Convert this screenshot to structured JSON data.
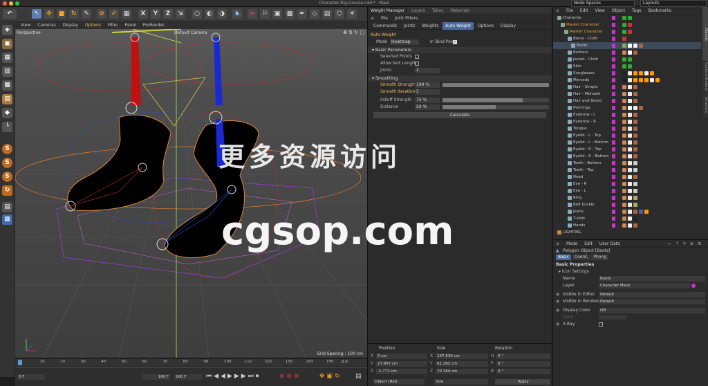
{
  "window": {
    "title": "Character-Rig-Course.c4d * - Main"
  },
  "node_spaces": {
    "label": "Node Spaces",
    "layouts": "Layouts"
  },
  "viewport": {
    "menu": [
      "View",
      "Cameras",
      "Display",
      "Options",
      "Filter",
      "Panel",
      "ProRender"
    ],
    "view_name": "Perspective",
    "camera": "Default Camera",
    "grid_spacing": "Grid Spacing : 100 cm"
  },
  "timeline": {
    "ticks": [
      "0",
      "10",
      "20",
      "30",
      "40",
      "50",
      "60",
      "70",
      "80",
      "90",
      "100",
      "110",
      "120",
      "130",
      "143",
      "150"
    ],
    "current_frame": "0 F",
    "frame_end": "160 F",
    "start_field": "0 F",
    "end_field_a": "160 F",
    "end_field_b": "160 F"
  },
  "weight_manager": {
    "tabs": [
      "Weight Manager",
      "Layers",
      "Takes",
      "Materials"
    ],
    "menu": [
      "File",
      "Joint Filters"
    ],
    "subtabs": [
      "Commands",
      "Joints",
      "Weights",
      "Auto Weight",
      "Options",
      "Display"
    ],
    "section": "Auto Weight",
    "mode_label": "Mode",
    "mode_value": "Heatmap",
    "bind_pose_label": "In Bind Pose",
    "basic_params": "Basic Parameters",
    "selected_points": "Selected Points",
    "allow_null_length": "Allow Null Length",
    "joints_label": "Joints",
    "joints_value": "2",
    "smoothing": "Smoothing",
    "smooth_strength_label": "Smooth Strength",
    "smooth_strength_value": "100 %",
    "smooth_strength": 1.0,
    "smooth_iterations_label": "Smooth Iterations",
    "smooth_iterations_value": "5",
    "falloff_label": "Falloff Strength",
    "falloff_value": "75 %",
    "falloff": 0.75,
    "distance_label": "Distance",
    "distance_value": "50 %",
    "distance": 0.5,
    "calculate": "Calculate"
  },
  "coords": {
    "headers": [
      "Position",
      "Size",
      "Rotation"
    ],
    "rows": [
      {
        "axis": "X",
        "pos": "0 cm",
        "size_axis": "X",
        "size": "107.639 cm",
        "rot_axis": "H",
        "rot": "0 °"
      },
      {
        "axis": "Y",
        "pos": "27.687 cm",
        "size_axis": "Y",
        "size": "61.262 cm",
        "rot_axis": "P",
        "rot": "0 °"
      },
      {
        "axis": "Z",
        "pos": "-1.772 cm",
        "size_axis": "Z",
        "size": "70.164 cm",
        "rot_axis": "B",
        "rot": "0 °"
      }
    ],
    "obj_mode": "Object (Rel)",
    "size_mode": "Size",
    "apply": "Apply"
  },
  "object_manager": {
    "menu": [
      "File",
      "Edit",
      "View",
      "Object",
      "Tags",
      "Bookmarks"
    ],
    "objects": [
      {
        "name": "Character",
        "indent": 0
      },
      {
        "name": "Master Character",
        "indent": 1
      },
      {
        "name": "Master Character",
        "indent": 2
      },
      {
        "name": "Boots - Cloth",
        "indent": 3
      },
      {
        "name": "Boots",
        "indent": 4
      },
      {
        "name": "Buttons",
        "indent": 3
      },
      {
        "name": "Jacket - Cloth",
        "indent": 3
      },
      {
        "name": "Skin",
        "indent": 3
      },
      {
        "name": "Sunglasses",
        "indent": 3
      },
      {
        "name": "Merseda",
        "indent": 3
      },
      {
        "name": "Hair - Simple",
        "indent": 3
      },
      {
        "name": "Hair - Mohawk",
        "indent": 3
      },
      {
        "name": "Hair and Beard",
        "indent": 3
      },
      {
        "name": "Piercings",
        "indent": 3
      },
      {
        "name": "Eyebrow - L",
        "indent": 3
      },
      {
        "name": "Eyebrow - R",
        "indent": 3
      },
      {
        "name": "Tongue",
        "indent": 3
      },
      {
        "name": "Eyelid - L - Top",
        "indent": 3
      },
      {
        "name": "Eyelid - L - Bottom",
        "indent": 3
      },
      {
        "name": "Eyelid - R - Top",
        "indent": 3
      },
      {
        "name": "Eyelid - R - Bottom",
        "indent": 3
      },
      {
        "name": "Teeth - Bottom",
        "indent": 3
      },
      {
        "name": "Teeth - Top",
        "indent": 3
      },
      {
        "name": "Head",
        "indent": 3
      },
      {
        "name": "Eye - R",
        "indent": 3
      },
      {
        "name": "Eye - L",
        "indent": 3
      },
      {
        "name": "Ring",
        "indent": 3
      },
      {
        "name": "Belt buckle",
        "indent": 3
      },
      {
        "name": "Jeans",
        "indent": 3
      },
      {
        "name": "T-shirt",
        "indent": 3
      },
      {
        "name": "Hands",
        "indent": 3
      },
      {
        "name": "LIGHTING",
        "indent": 0
      }
    ],
    "side_tabs": [
      "Objects",
      "Content Browser",
      "Structure"
    ]
  },
  "attributes": {
    "menu": [
      "Mode",
      "Edit",
      "User Data"
    ],
    "object_type": "Polygon Object [Boots]",
    "tabs": [
      "Basic",
      "Coord.",
      "Phong"
    ],
    "section": "Basic Properties",
    "icon_settings": "Icon Settings",
    "name_label": "Name",
    "name_value": "Boots",
    "layer_label": "Layer",
    "layer_value": "Character Mesh",
    "visible_editor_label": "Visible in Editor",
    "visible_editor_value": "Default",
    "visible_renderer_label": "Visible in Renderer",
    "visible_renderer_value": "Default",
    "display_color_label": "Display Color",
    "display_color_value": "Off",
    "color_label": "Color",
    "xray_label": "X-Ray"
  },
  "watermark": {
    "line1": "更多资源访问",
    "line2": "cgsop.com"
  },
  "colors": {
    "accent": "#f5a623",
    "magenta": "#d030d0",
    "joint_red": "#d01010",
    "joint_blue": "#1e2ed8"
  }
}
